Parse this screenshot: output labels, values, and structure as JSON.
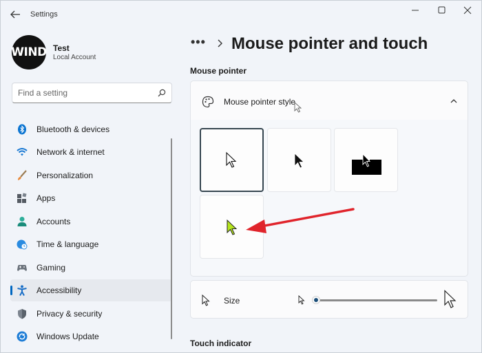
{
  "window": {
    "title": "Settings",
    "controls": {
      "minimize": "minimize",
      "maximize": "maximize",
      "close": "close"
    }
  },
  "profile": {
    "avatar_text": "WIND",
    "name": "Test",
    "account_type": "Local Account"
  },
  "search": {
    "placeholder": "Find a setting",
    "icon": "search-icon"
  },
  "nav": {
    "items": [
      {
        "label": "Bluetooth & devices",
        "icon": "bluetooth-icon",
        "active": false
      },
      {
        "label": "Network & internet",
        "icon": "wifi-icon",
        "active": false
      },
      {
        "label": "Personalization",
        "icon": "brush-icon",
        "active": false
      },
      {
        "label": "Apps",
        "icon": "apps-icon",
        "active": false
      },
      {
        "label": "Accounts",
        "icon": "person-icon",
        "active": false
      },
      {
        "label": "Time & language",
        "icon": "globe-clock-icon",
        "active": false
      },
      {
        "label": "Gaming",
        "icon": "gamepad-icon",
        "active": false
      },
      {
        "label": "Accessibility",
        "icon": "accessibility-icon",
        "active": true
      },
      {
        "label": "Privacy & security",
        "icon": "shield-icon",
        "active": false
      },
      {
        "label": "Windows Update",
        "icon": "update-icon",
        "active": false
      }
    ]
  },
  "breadcrumb": {
    "dots": "•••",
    "title": "Mouse pointer and touch"
  },
  "sections": {
    "mouse_pointer": "Mouse pointer",
    "touch_indicator": "Touch indicator"
  },
  "pointer_style": {
    "label": "Mouse pointer style",
    "expanded": true,
    "options": [
      {
        "name": "white",
        "selected": true
      },
      {
        "name": "black",
        "selected": false
      },
      {
        "name": "inverted",
        "selected": false
      },
      {
        "name": "custom",
        "color": "#b5e61d",
        "selected": false
      }
    ]
  },
  "size": {
    "label": "Size",
    "value": 1
  },
  "colors": {
    "accent": "#0067c0",
    "annotation_arrow": "#e0242b",
    "custom_pointer": "#b5e61d"
  }
}
